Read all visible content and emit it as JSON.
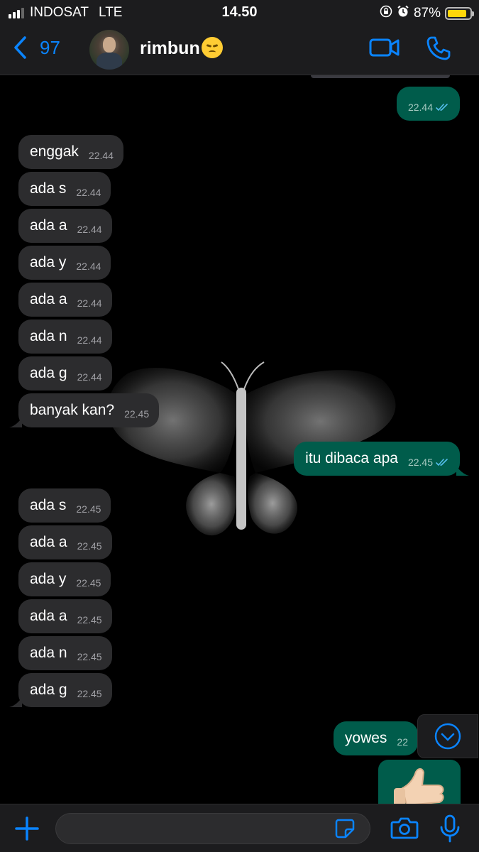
{
  "status_bar": {
    "carrier": "INDOSAT",
    "network": "LTE",
    "time": "14.50",
    "battery": "87%",
    "battery_level": 0.87
  },
  "header": {
    "back_count": "97",
    "contact_name": "rimbun",
    "contact_emoji": "disappointed-face"
  },
  "messages": [
    {
      "dir": "out",
      "text": "",
      "time": "22.44",
      "read": true
    },
    {
      "dir": "in",
      "text": "enggak",
      "time": "22.44"
    },
    {
      "dir": "in",
      "text": "ada s",
      "time": "22.44"
    },
    {
      "dir": "in",
      "text": "ada a",
      "time": "22.44"
    },
    {
      "dir": "in",
      "text": "ada y",
      "time": "22.44"
    },
    {
      "dir": "in",
      "text": "ada a",
      "time": "22.44"
    },
    {
      "dir": "in",
      "text": "ada n",
      "time": "22.44"
    },
    {
      "dir": "in",
      "text": "ada g",
      "time": "22.44"
    },
    {
      "dir": "in",
      "text": "banyak kan?",
      "time": "22.45"
    },
    {
      "dir": "out",
      "text": "itu dibaca apa",
      "time": "22.45",
      "read": true
    },
    {
      "dir": "in",
      "text": "ada s",
      "time": "22.45"
    },
    {
      "dir": "in",
      "text": "ada a",
      "time": "22.45"
    },
    {
      "dir": "in",
      "text": "ada y",
      "time": "22.45"
    },
    {
      "dir": "in",
      "text": "ada a",
      "time": "22.45"
    },
    {
      "dir": "in",
      "text": "ada n",
      "time": "22.45"
    },
    {
      "dir": "in",
      "text": "ada g",
      "time": "22.45"
    },
    {
      "dir": "out",
      "text": "yowes",
      "time": "22"
    },
    {
      "dir": "out",
      "type": "sticker",
      "sticker": "thumbs-up"
    }
  ],
  "input": {
    "placeholder": "",
    "value": ""
  },
  "colors": {
    "accent": "#0a84ff",
    "incoming_bubble": "#2c2c2e",
    "outgoing_bubble": "#005c4b",
    "read_tick": "#53bdeb"
  }
}
